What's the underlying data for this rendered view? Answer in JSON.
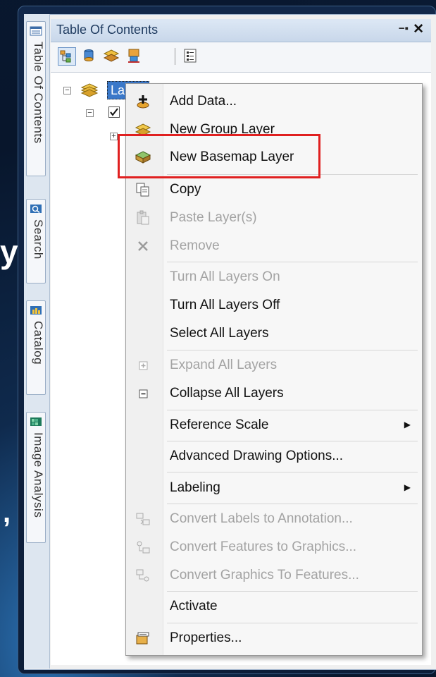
{
  "panel": {
    "title": "Table Of Contents",
    "pin_symbol": "−▪",
    "close_symbol": "✕"
  },
  "side_tabs": [
    {
      "label": "Table Of Contents",
      "icon": "table-of-contents-icon"
    },
    {
      "label": "Search",
      "icon": "search-icon"
    },
    {
      "label": "Catalog",
      "icon": "catalog-icon"
    },
    {
      "label": "Image Analysis",
      "icon": "image-analysis-icon"
    }
  ],
  "background_glyphs": [
    "y",
    ","
  ],
  "tree": {
    "root_label": "La",
    "expanded_symbol": "−",
    "collapsed_symbol": "+"
  },
  "context_menu": {
    "items": [
      {
        "label": "Add Data...",
        "icon": "add-data-icon",
        "enabled": true
      },
      {
        "label": "New Group Layer",
        "icon": "group-layer-icon",
        "enabled": true
      },
      {
        "label": "New Basemap Layer",
        "icon": "basemap-layer-icon",
        "enabled": true,
        "highlighted": true
      },
      {
        "label": "Copy",
        "icon": "copy-icon",
        "enabled": true
      },
      {
        "label": "Paste Layer(s)",
        "icon": "paste-icon",
        "enabled": false
      },
      {
        "label": "Remove",
        "icon": "remove-icon",
        "enabled": false
      },
      {
        "label": "Turn All Layers On",
        "enabled": false
      },
      {
        "label": "Turn All Layers Off",
        "enabled": true
      },
      {
        "label": "Select All Layers",
        "enabled": true
      },
      {
        "label": "Expand All Layers",
        "icon": "expand-icon",
        "enabled": false
      },
      {
        "label": "Collapse All Layers",
        "icon": "collapse-icon",
        "enabled": true
      },
      {
        "label": "Reference Scale",
        "enabled": true,
        "submenu": true
      },
      {
        "label": "Advanced Drawing Options...",
        "enabled": true
      },
      {
        "label": "Labeling",
        "enabled": true,
        "submenu": true
      },
      {
        "label": "Convert Labels to Annotation...",
        "icon": "convert-labels-icon",
        "enabled": false
      },
      {
        "label": "Convert Features to Graphics...",
        "icon": "convert-features-icon",
        "enabled": false
      },
      {
        "label": "Convert Graphics To Features...",
        "icon": "convert-graphics-icon",
        "enabled": false
      },
      {
        "label": "Activate",
        "enabled": true
      },
      {
        "label": "Properties...",
        "icon": "properties-icon",
        "enabled": true
      }
    ],
    "submenu_arrow": "▶"
  },
  "colors": {
    "highlight_border": "#e02020",
    "disabled_text": "#a3a3a3",
    "title_text": "#1e3a5f"
  }
}
